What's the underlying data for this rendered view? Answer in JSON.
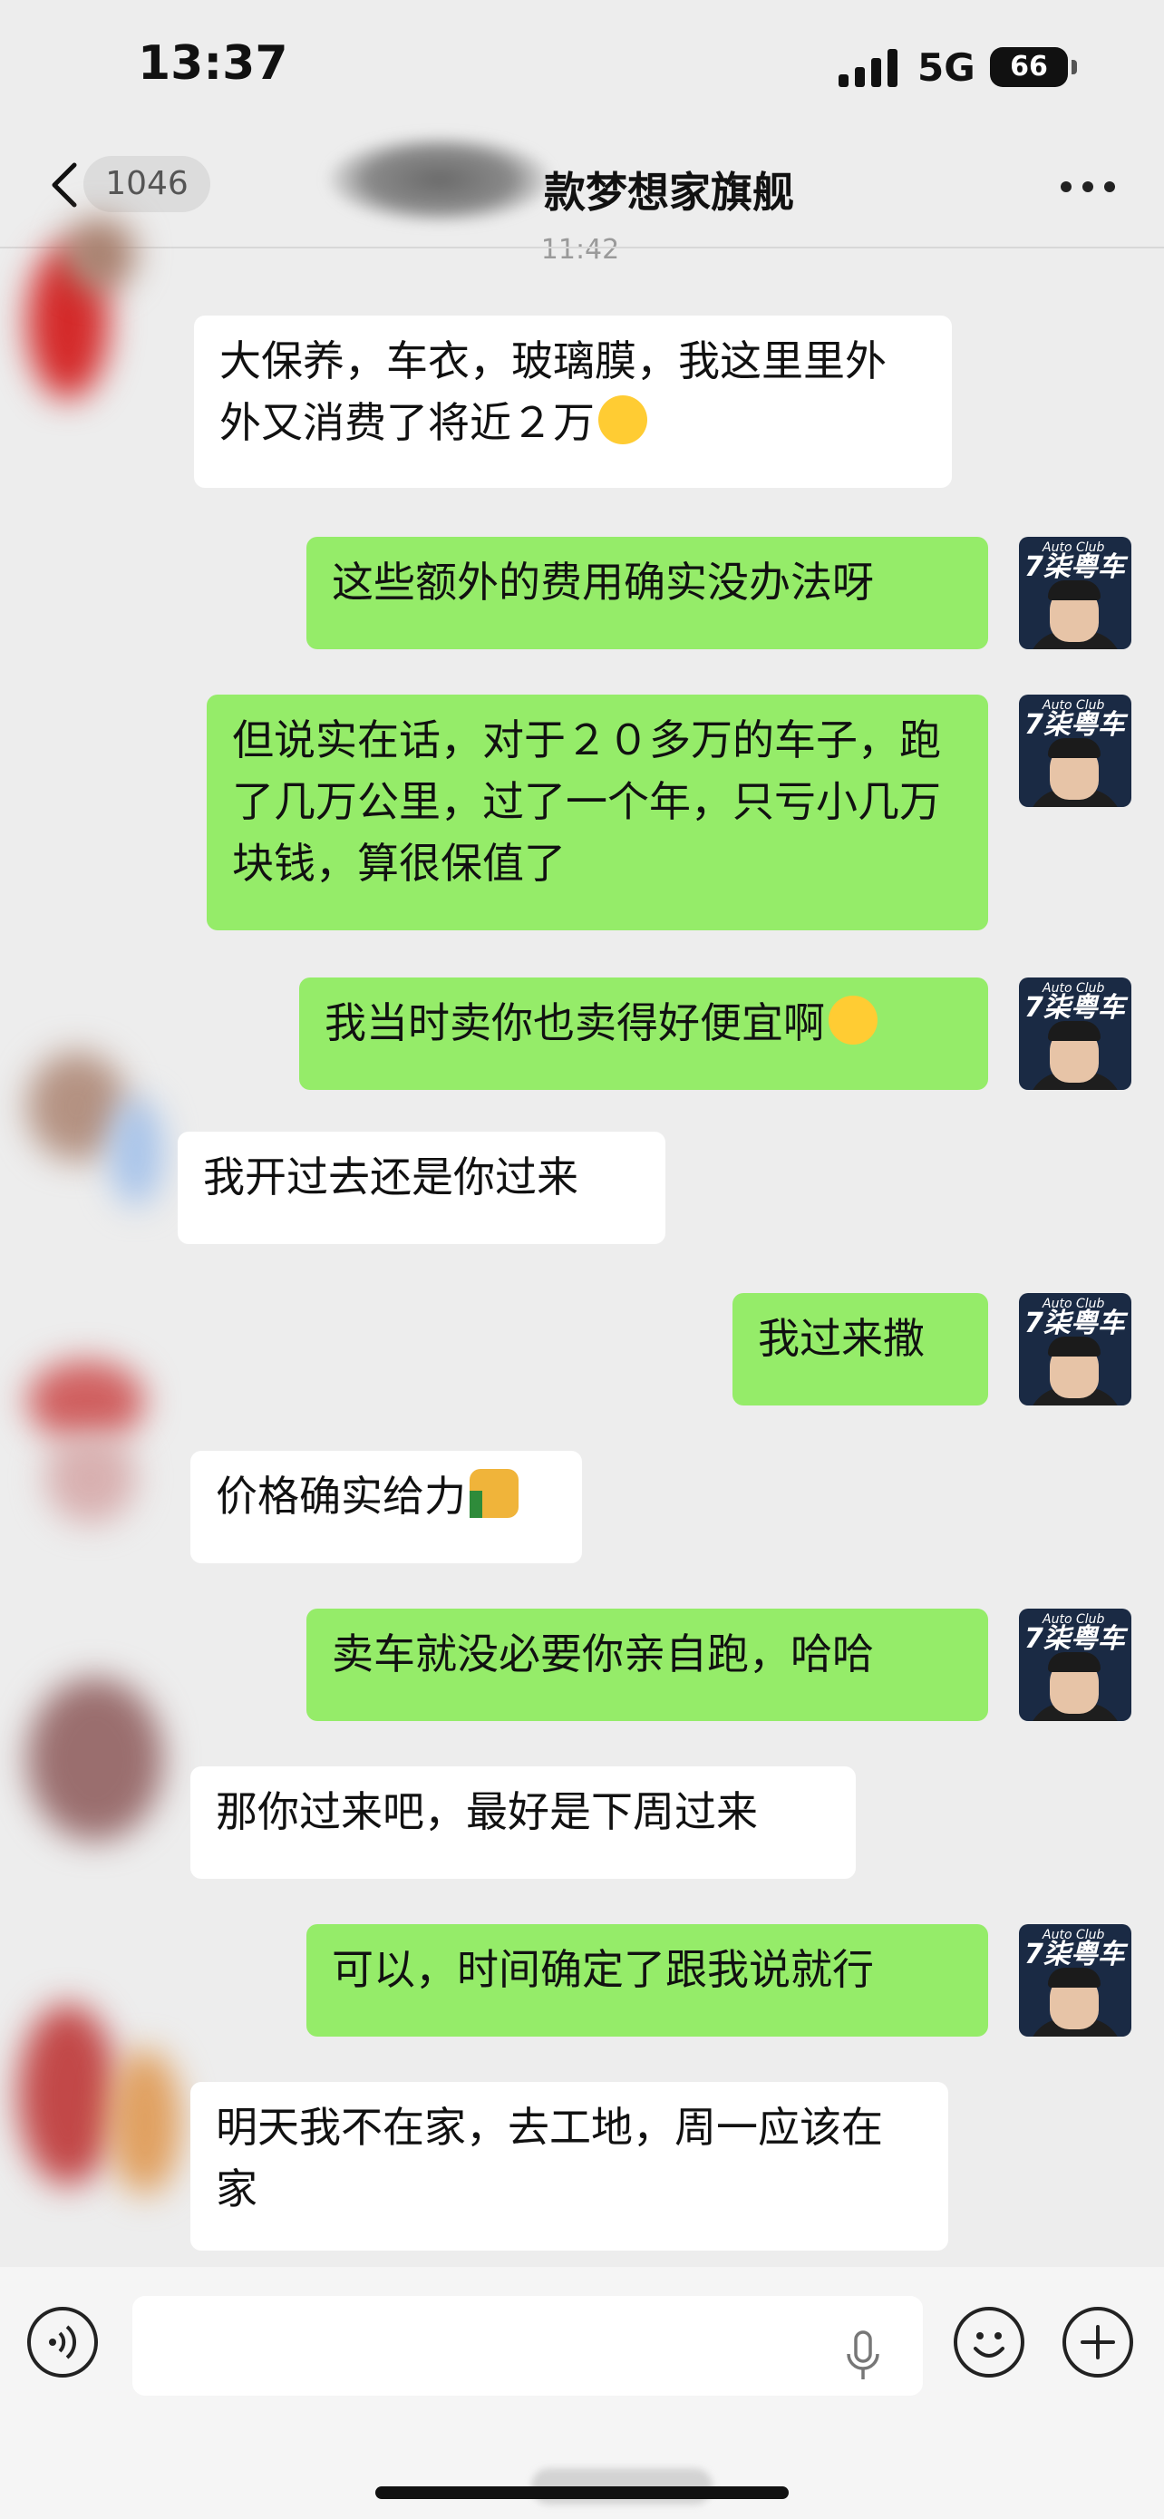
{
  "status_bar": {
    "time": "13:37",
    "network": "5G",
    "battery": "66"
  },
  "nav": {
    "unread_count": "1046",
    "title": "款梦想家旗舰",
    "timestamp": "11:42"
  },
  "avatar_brand": {
    "text": "7柒粤车",
    "sub": "Auto Club"
  },
  "messages": [
    {
      "side": "in",
      "text": "大保养，车衣，玻璃膜，我这里里外外又消费了将近２万",
      "emoji": "laugh-cry"
    },
    {
      "side": "out",
      "text": "这些额外的费用确实没办法呀"
    },
    {
      "side": "out",
      "text": "但说实在话，对于２０多万的车子，跑了几万公里，过了一个年，只亏小几万块钱，算很保值了"
    },
    {
      "side": "out",
      "text": "我当时卖你也卖得好便宜啊",
      "emoji": "joy"
    },
    {
      "side": "in",
      "text": "我开过去还是你过来"
    },
    {
      "side": "out",
      "text": "我过来撒"
    },
    {
      "side": "in",
      "text": "价格确实给力",
      "emoji": "thumbs-up"
    },
    {
      "side": "out",
      "text": "卖车就没必要你亲自跑，哈哈"
    },
    {
      "side": "in",
      "text": "那你过来吧，最好是下周过来"
    },
    {
      "side": "out",
      "text": "可以，时间确定了跟我说就行"
    },
    {
      "side": "in",
      "text": "明天我不在家，去工地，周一应该在家"
    }
  ],
  "icons": {
    "back": "chevron-left-icon",
    "more": "more-dots-icon",
    "voice": "voice-icon",
    "mic": "mic-icon",
    "emoji": "emoji-icon",
    "plus": "plus-icon"
  },
  "colors": {
    "background": "#ededed",
    "incoming_bubble": "#ffffff",
    "outgoing_bubble": "#95ec69"
  }
}
